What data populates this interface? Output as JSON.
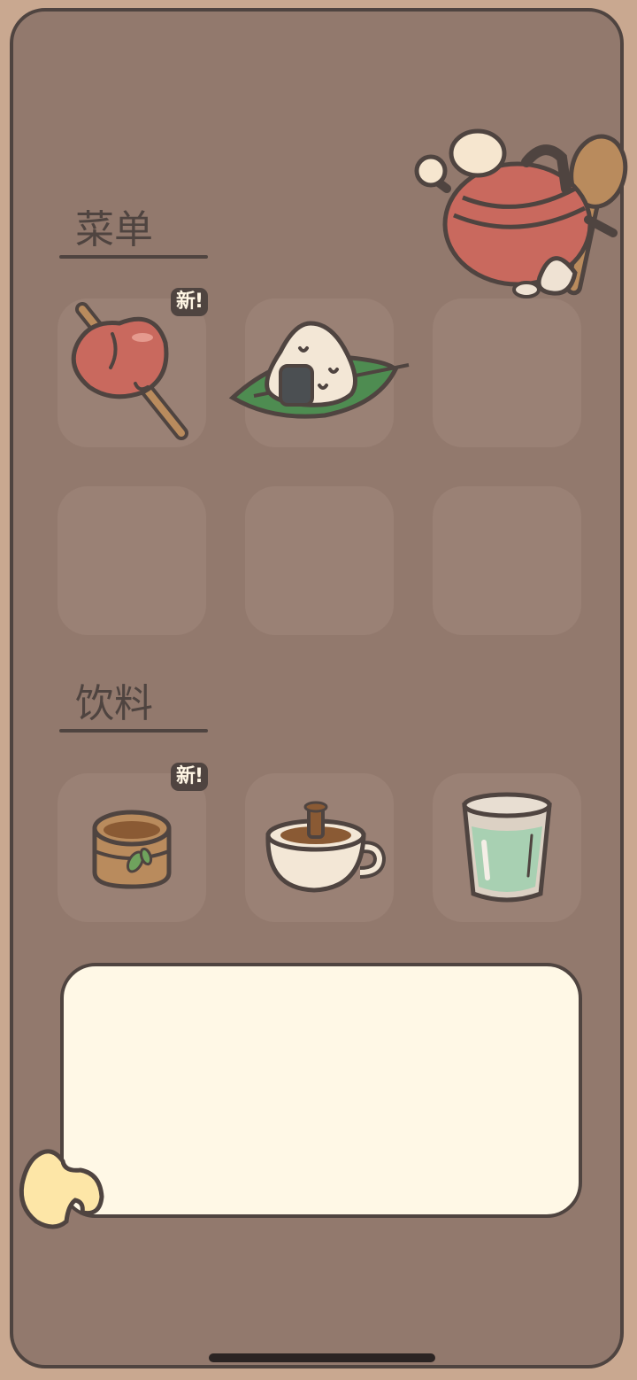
{
  "menu": {
    "title": "菜单",
    "items": [
      {
        "icon": "candied-apple-icon",
        "new": true,
        "badge": "新!"
      },
      {
        "icon": "rice-ball-icon",
        "new": false
      },
      {
        "icon": "",
        "new": false
      },
      {
        "icon": "",
        "new": false
      },
      {
        "icon": "",
        "new": false
      },
      {
        "icon": "",
        "new": false
      }
    ]
  },
  "drinks": {
    "title": "饮料",
    "items": [
      {
        "icon": "tea-cup-icon",
        "new": true,
        "badge": "新!"
      },
      {
        "icon": "coffee-mug-icon",
        "new": false
      },
      {
        "icon": "water-glass-icon",
        "new": false
      }
    ]
  },
  "colors": {
    "panel": "#92796D",
    "slot": "#9A8175",
    "outline": "#4F4440",
    "dialog": "#FFF8E6",
    "frame": "#C9A890"
  }
}
